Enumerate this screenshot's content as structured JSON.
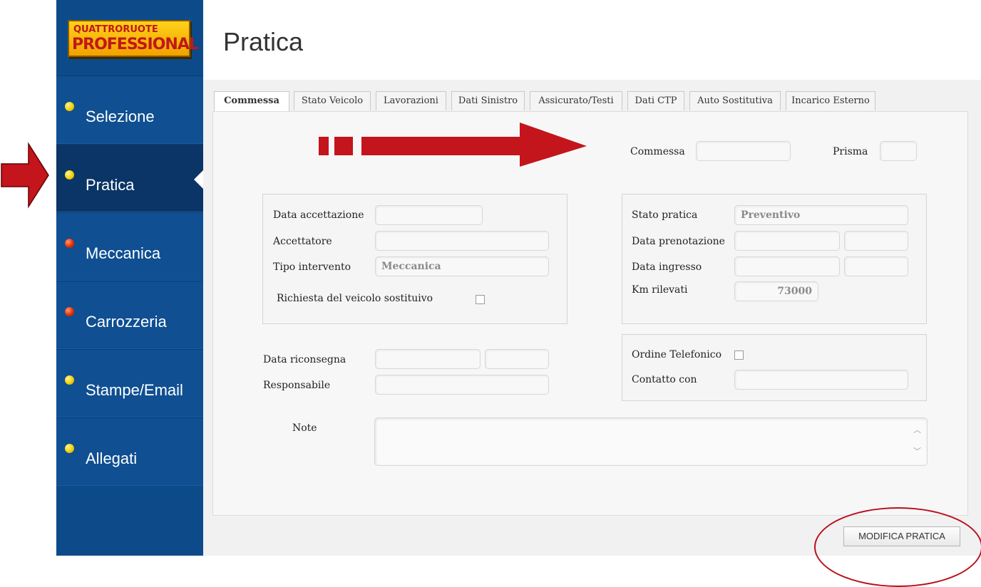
{
  "app": {
    "logo": {
      "line1": "QUATTRORUOTE",
      "line2": "PROFESSIONAL"
    },
    "page_title": "Pratica"
  },
  "sidebar": {
    "items": [
      {
        "label": "Selezione",
        "dot_color": "#f5d000"
      },
      {
        "label": "Pratica",
        "dot_color": "#f5d000",
        "active": true
      },
      {
        "label": "Meccanica",
        "dot_color": "#e83000"
      },
      {
        "label": "Carrozzeria",
        "dot_color": "#e83000"
      },
      {
        "label": "Stampe/Email",
        "dot_color": "#f5d000"
      },
      {
        "label": "Allegati",
        "dot_color": "#f5d000"
      }
    ]
  },
  "tabs": [
    {
      "label": "Commessa",
      "active": true
    },
    {
      "label": "Stato Veicolo"
    },
    {
      "label": "Lavorazioni"
    },
    {
      "label": "Dati Sinistro"
    },
    {
      "label": "Assicurato/Testi"
    },
    {
      "label": "Dati CTP"
    },
    {
      "label": "Auto Sostitutiva"
    },
    {
      "label": "Incarico Esterno"
    }
  ],
  "form": {
    "commessa": {
      "label": "Commessa",
      "value": ""
    },
    "prisma": {
      "label": "Prisma",
      "value": ""
    },
    "data_accettazione": {
      "label": "Data accettazione",
      "value": ""
    },
    "accettatore": {
      "label": "Accettatore",
      "value": ""
    },
    "tipo_intervento": {
      "label": "Tipo intervento",
      "value": "Meccanica"
    },
    "richiesta_veicolo": {
      "label": "Richiesta del veicolo sostituivo",
      "checked": false
    },
    "stato_pratica": {
      "label": "Stato pratica",
      "value": "Preventivo"
    },
    "data_prenotazione": {
      "label": "Data prenotazione",
      "value": "",
      "time": ""
    },
    "data_ingresso": {
      "label": "Data ingresso",
      "value": "",
      "time": ""
    },
    "km_rilevati": {
      "label": "Km rilevati",
      "value": "73000"
    },
    "ordine_telefonico": {
      "label": "Ordine Telefonico",
      "checked": false
    },
    "contatto_con": {
      "label": "Contatto con",
      "value": ""
    },
    "data_riconsegna": {
      "label": "Data riconsegna",
      "value": "",
      "time": ""
    },
    "responsabile": {
      "label": "Responsabile",
      "value": ""
    },
    "note": {
      "label": "Note",
      "value": ""
    }
  },
  "actions": {
    "modifica_label": "MODIFICA PRATICA"
  },
  "colors": {
    "sidebar": "#0d4a8a",
    "sidebar_active": "#0a3566",
    "annotation_red": "#b8101c"
  }
}
